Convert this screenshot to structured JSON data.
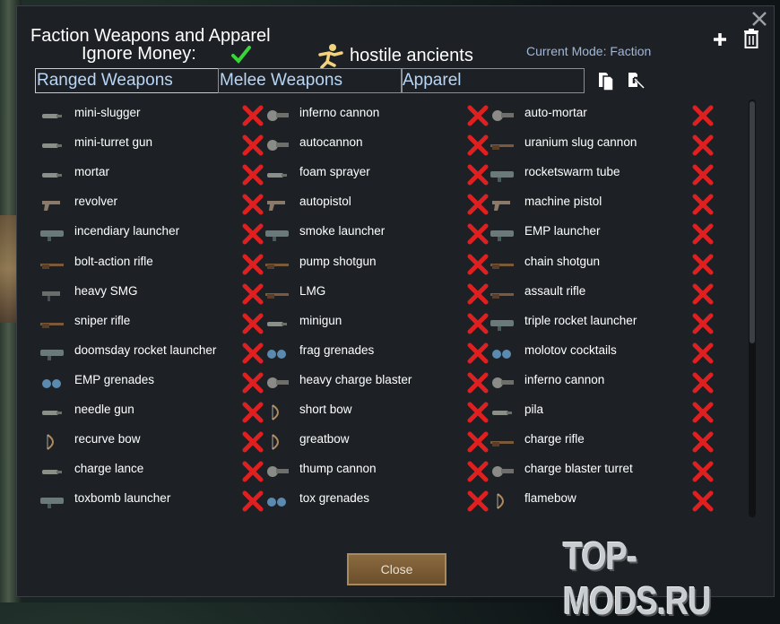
{
  "dialog": {
    "title": "Faction Weapons and Apparel",
    "ignore_money_label": "Ignore Money:",
    "faction_name": "hostile ancients",
    "mode_text": "Current Mode: Faction",
    "close_button_label": "Close"
  },
  "tabs": [
    {
      "label": "Ranged Weapons",
      "active": true
    },
    {
      "label": "Melee Weapons",
      "active": false
    },
    {
      "label": "Apparel",
      "active": false
    }
  ],
  "colors": {
    "panel_bg": "#1d2125",
    "tab_text": "#b8d6f6",
    "mode_text": "#9fb7d8",
    "check_green": "#3ad43a",
    "x_red": "#e02020"
  },
  "columns": [
    {
      "items": [
        {
          "label": "mini-slugger",
          "icon": "weapon-icon"
        },
        {
          "label": "mini-turret gun",
          "icon": "weapon-icon"
        },
        {
          "label": "mortar",
          "icon": "weapon-icon"
        },
        {
          "label": "revolver",
          "icon": "pistol-icon"
        },
        {
          "label": "incendiary launcher",
          "icon": "launcher-icon"
        },
        {
          "label": "bolt-action rifle",
          "icon": "rifle-icon"
        },
        {
          "label": "heavy SMG",
          "icon": "smg-icon"
        },
        {
          "label": "sniper rifle",
          "icon": "rifle-icon"
        },
        {
          "label": "doomsday rocket launcher",
          "icon": "launcher-icon"
        },
        {
          "label": "EMP grenades",
          "icon": "grenade-icon"
        },
        {
          "label": "needle gun",
          "icon": "weapon-icon"
        },
        {
          "label": "recurve bow",
          "icon": "bow-icon"
        },
        {
          "label": "charge lance",
          "icon": "weapon-icon"
        },
        {
          "label": "toxbomb launcher",
          "icon": "launcher-icon"
        }
      ]
    },
    {
      "items": [
        {
          "label": "inferno cannon",
          "icon": "cannon-icon"
        },
        {
          "label": "autocannon",
          "icon": "cannon-icon"
        },
        {
          "label": "foam sprayer",
          "icon": "weapon-icon"
        },
        {
          "label": "autopistol",
          "icon": "pistol-icon"
        },
        {
          "label": "smoke launcher",
          "icon": "launcher-icon"
        },
        {
          "label": "pump shotgun",
          "icon": "rifle-icon"
        },
        {
          "label": "LMG",
          "icon": "rifle-icon"
        },
        {
          "label": "minigun",
          "icon": "weapon-icon"
        },
        {
          "label": "frag grenades",
          "icon": "grenade-icon"
        },
        {
          "label": "heavy charge blaster",
          "icon": "cannon-icon"
        },
        {
          "label": "short bow",
          "icon": "bow-icon"
        },
        {
          "label": "greatbow",
          "icon": "bow-icon"
        },
        {
          "label": "thump cannon",
          "icon": "cannon-icon"
        },
        {
          "label": "tox grenades",
          "icon": "grenade-icon"
        }
      ]
    },
    {
      "items": [
        {
          "label": "auto-mortar",
          "icon": "cannon-icon"
        },
        {
          "label": "uranium slug cannon",
          "icon": "rifle-icon"
        },
        {
          "label": "rocketswarm tube",
          "icon": "launcher-icon"
        },
        {
          "label": "machine pistol",
          "icon": "pistol-icon"
        },
        {
          "label": "EMP launcher",
          "icon": "launcher-icon"
        },
        {
          "label": "chain shotgun",
          "icon": "rifle-icon"
        },
        {
          "label": "assault rifle",
          "icon": "rifle-icon"
        },
        {
          "label": "triple rocket launcher",
          "icon": "launcher-icon"
        },
        {
          "label": "molotov cocktails",
          "icon": "grenade-icon"
        },
        {
          "label": "inferno cannon",
          "icon": "cannon-icon"
        },
        {
          "label": "pila",
          "icon": "weapon-icon"
        },
        {
          "label": "charge rifle",
          "icon": "rifle-icon"
        },
        {
          "label": "charge blaster turret",
          "icon": "cannon-icon"
        },
        {
          "label": "flamebow",
          "icon": "bow-icon"
        }
      ]
    }
  ],
  "watermark": "TOP-MODS.RU"
}
